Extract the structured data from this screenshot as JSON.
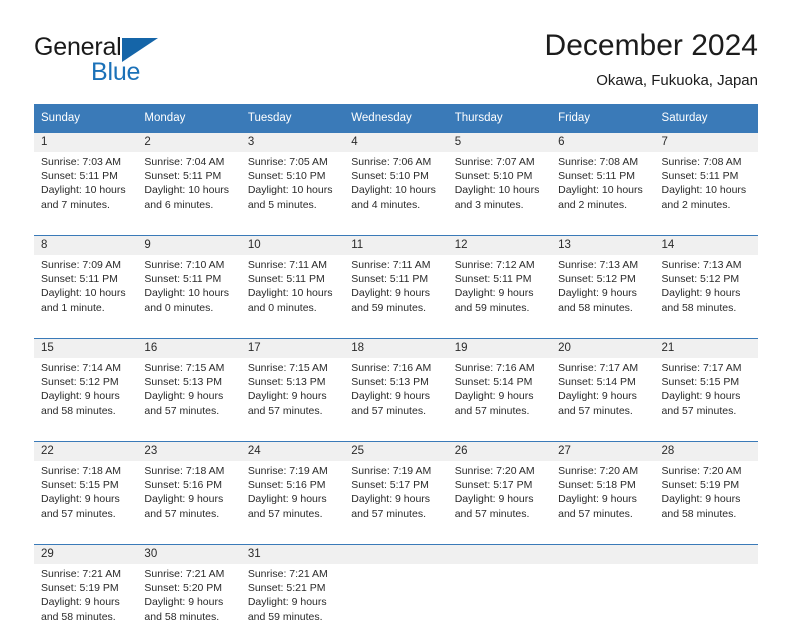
{
  "brand": {
    "name_part1": "General",
    "name_part2": "Blue",
    "triangle_icon": "brand-triangle-icon",
    "color_dark": "#1a1a1a",
    "color_blue": "#1b71b8"
  },
  "header": {
    "title": "December 2024",
    "subtitle": "Okawa, Fukuoka, Japan"
  },
  "calendar": {
    "accent_color": "#3a7ab8",
    "daynum_bg": "#f0f0f0",
    "weekdays": [
      "Sunday",
      "Monday",
      "Tuesday",
      "Wednesday",
      "Thursday",
      "Friday",
      "Saturday"
    ],
    "weeks": [
      [
        {
          "day": "1",
          "sunrise": "Sunrise: 7:03 AM",
          "sunset": "Sunset: 5:11 PM",
          "daylight": "Daylight: 10 hours and 7 minutes."
        },
        {
          "day": "2",
          "sunrise": "Sunrise: 7:04 AM",
          "sunset": "Sunset: 5:11 PM",
          "daylight": "Daylight: 10 hours and 6 minutes."
        },
        {
          "day": "3",
          "sunrise": "Sunrise: 7:05 AM",
          "sunset": "Sunset: 5:10 PM",
          "daylight": "Daylight: 10 hours and 5 minutes."
        },
        {
          "day": "4",
          "sunrise": "Sunrise: 7:06 AM",
          "sunset": "Sunset: 5:10 PM",
          "daylight": "Daylight: 10 hours and 4 minutes."
        },
        {
          "day": "5",
          "sunrise": "Sunrise: 7:07 AM",
          "sunset": "Sunset: 5:10 PM",
          "daylight": "Daylight: 10 hours and 3 minutes."
        },
        {
          "day": "6",
          "sunrise": "Sunrise: 7:08 AM",
          "sunset": "Sunset: 5:11 PM",
          "daylight": "Daylight: 10 hours and 2 minutes."
        },
        {
          "day": "7",
          "sunrise": "Sunrise: 7:08 AM",
          "sunset": "Sunset: 5:11 PM",
          "daylight": "Daylight: 10 hours and 2 minutes."
        }
      ],
      [
        {
          "day": "8",
          "sunrise": "Sunrise: 7:09 AM",
          "sunset": "Sunset: 5:11 PM",
          "daylight": "Daylight: 10 hours and 1 minute."
        },
        {
          "day": "9",
          "sunrise": "Sunrise: 7:10 AM",
          "sunset": "Sunset: 5:11 PM",
          "daylight": "Daylight: 10 hours and 0 minutes."
        },
        {
          "day": "10",
          "sunrise": "Sunrise: 7:11 AM",
          "sunset": "Sunset: 5:11 PM",
          "daylight": "Daylight: 10 hours and 0 minutes."
        },
        {
          "day": "11",
          "sunrise": "Sunrise: 7:11 AM",
          "sunset": "Sunset: 5:11 PM",
          "daylight": "Daylight: 9 hours and 59 minutes."
        },
        {
          "day": "12",
          "sunrise": "Sunrise: 7:12 AM",
          "sunset": "Sunset: 5:11 PM",
          "daylight": "Daylight: 9 hours and 59 minutes."
        },
        {
          "day": "13",
          "sunrise": "Sunrise: 7:13 AM",
          "sunset": "Sunset: 5:12 PM",
          "daylight": "Daylight: 9 hours and 58 minutes."
        },
        {
          "day": "14",
          "sunrise": "Sunrise: 7:13 AM",
          "sunset": "Sunset: 5:12 PM",
          "daylight": "Daylight: 9 hours and 58 minutes."
        }
      ],
      [
        {
          "day": "15",
          "sunrise": "Sunrise: 7:14 AM",
          "sunset": "Sunset: 5:12 PM",
          "daylight": "Daylight: 9 hours and 58 minutes."
        },
        {
          "day": "16",
          "sunrise": "Sunrise: 7:15 AM",
          "sunset": "Sunset: 5:13 PM",
          "daylight": "Daylight: 9 hours and 57 minutes."
        },
        {
          "day": "17",
          "sunrise": "Sunrise: 7:15 AM",
          "sunset": "Sunset: 5:13 PM",
          "daylight": "Daylight: 9 hours and 57 minutes."
        },
        {
          "day": "18",
          "sunrise": "Sunrise: 7:16 AM",
          "sunset": "Sunset: 5:13 PM",
          "daylight": "Daylight: 9 hours and 57 minutes."
        },
        {
          "day": "19",
          "sunrise": "Sunrise: 7:16 AM",
          "sunset": "Sunset: 5:14 PM",
          "daylight": "Daylight: 9 hours and 57 minutes."
        },
        {
          "day": "20",
          "sunrise": "Sunrise: 7:17 AM",
          "sunset": "Sunset: 5:14 PM",
          "daylight": "Daylight: 9 hours and 57 minutes."
        },
        {
          "day": "21",
          "sunrise": "Sunrise: 7:17 AM",
          "sunset": "Sunset: 5:15 PM",
          "daylight": "Daylight: 9 hours and 57 minutes."
        }
      ],
      [
        {
          "day": "22",
          "sunrise": "Sunrise: 7:18 AM",
          "sunset": "Sunset: 5:15 PM",
          "daylight": "Daylight: 9 hours and 57 minutes."
        },
        {
          "day": "23",
          "sunrise": "Sunrise: 7:18 AM",
          "sunset": "Sunset: 5:16 PM",
          "daylight": "Daylight: 9 hours and 57 minutes."
        },
        {
          "day": "24",
          "sunrise": "Sunrise: 7:19 AM",
          "sunset": "Sunset: 5:16 PM",
          "daylight": "Daylight: 9 hours and 57 minutes."
        },
        {
          "day": "25",
          "sunrise": "Sunrise: 7:19 AM",
          "sunset": "Sunset: 5:17 PM",
          "daylight": "Daylight: 9 hours and 57 minutes."
        },
        {
          "day": "26",
          "sunrise": "Sunrise: 7:20 AM",
          "sunset": "Sunset: 5:17 PM",
          "daylight": "Daylight: 9 hours and 57 minutes."
        },
        {
          "day": "27",
          "sunrise": "Sunrise: 7:20 AM",
          "sunset": "Sunset: 5:18 PM",
          "daylight": "Daylight: 9 hours and 57 minutes."
        },
        {
          "day": "28",
          "sunrise": "Sunrise: 7:20 AM",
          "sunset": "Sunset: 5:19 PM",
          "daylight": "Daylight: 9 hours and 58 minutes."
        }
      ],
      [
        {
          "day": "29",
          "sunrise": "Sunrise: 7:21 AM",
          "sunset": "Sunset: 5:19 PM",
          "daylight": "Daylight: 9 hours and 58 minutes."
        },
        {
          "day": "30",
          "sunrise": "Sunrise: 7:21 AM",
          "sunset": "Sunset: 5:20 PM",
          "daylight": "Daylight: 9 hours and 58 minutes."
        },
        {
          "day": "31",
          "sunrise": "Sunrise: 7:21 AM",
          "sunset": "Sunset: 5:21 PM",
          "daylight": "Daylight: 9 hours and 59 minutes."
        },
        {
          "day": "",
          "sunrise": "",
          "sunset": "",
          "daylight": ""
        },
        {
          "day": "",
          "sunrise": "",
          "sunset": "",
          "daylight": ""
        },
        {
          "day": "",
          "sunrise": "",
          "sunset": "",
          "daylight": ""
        },
        {
          "day": "",
          "sunrise": "",
          "sunset": "",
          "daylight": ""
        }
      ]
    ]
  }
}
